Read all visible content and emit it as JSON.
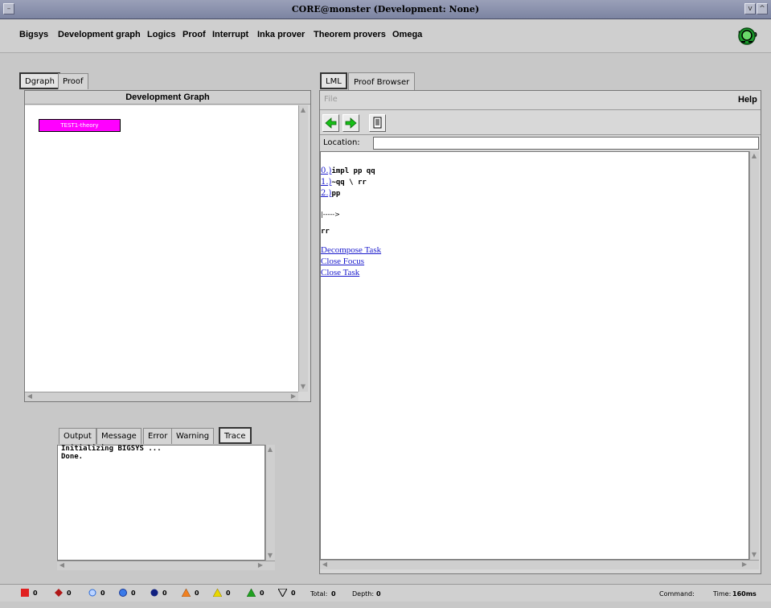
{
  "window": {
    "title": "CORE@monster (Development: None)"
  },
  "menubar": {
    "items": [
      "Bigsys",
      "Development graph",
      "Logics",
      "Proof",
      "Interrupt",
      "Inka prover",
      "Theorem provers",
      "Omega"
    ],
    "help": "Help"
  },
  "left_tabs": [
    "Dgraph",
    "Proof"
  ],
  "dev_graph": {
    "header": "Development Graph",
    "node_label": "TEST1-theory"
  },
  "output_tabs": [
    "Output",
    "Message",
    "Error",
    "Warning",
    "Trace"
  ],
  "output": {
    "line1": "Initializing BIGSYS ...",
    "line2": "Done."
  },
  "right_tabs": [
    "LML",
    "Proof Browser"
  ],
  "lml_menu": {
    "file": "File",
    "help": "Help"
  },
  "location": {
    "label": "Location:",
    "value": ""
  },
  "lml": {
    "lines": [
      {
        "num": "0.)",
        "text": "impl pp qq"
      },
      {
        "num": "1.)",
        "text": "~qq \\ rr"
      },
      {
        "num": "2.)",
        "text": "pp"
      }
    ],
    "arrow": "|----->",
    "goal": "rr",
    "links": [
      "Decompose Task",
      "Close Focus",
      "Close Task"
    ]
  },
  "status": {
    "legend": [
      {
        "icon": "red-square-icon",
        "value": "0",
        "color": "#e02020"
      },
      {
        "icon": "red-diamond-icon",
        "value": "0",
        "color": "#b01818"
      },
      {
        "icon": "blue-circle-outline-icon",
        "value": "0",
        "color": "#2a6ad8"
      },
      {
        "icon": "blue-circle-icon",
        "value": "0",
        "color": "#3a7ae8"
      },
      {
        "icon": "navy-circle-icon",
        "value": "0",
        "color": "#102080"
      },
      {
        "icon": "orange-triangle-icon",
        "value": "0",
        "color": "#f08020"
      },
      {
        "icon": "yellow-triangle-icon",
        "value": "0",
        "color": "#e8d800"
      },
      {
        "icon": "green-triangle-icon",
        "value": "0",
        "color": "#20a020"
      },
      {
        "icon": "triangle-down-icon",
        "value": "0",
        "color": "#000000"
      }
    ],
    "total_label": "Total:",
    "total_value": "0",
    "depth_label": "Depth:",
    "depth_value": "0",
    "command_label": "Command:",
    "time_label": "Time:",
    "time_value": "160ms"
  }
}
